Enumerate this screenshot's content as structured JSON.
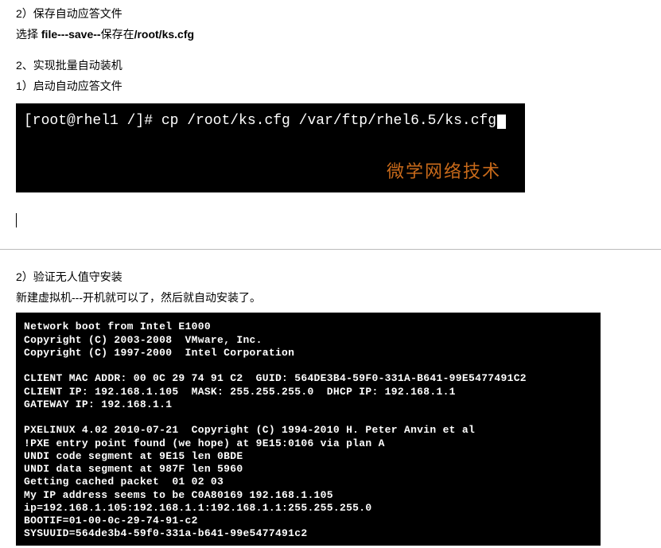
{
  "text": {
    "p1": "2）保存自动应答文件",
    "p2_prefix": "选择 ",
    "p2_bold": "file---save--",
    "p2_suffix": "保存在",
    "p2_path": "/root/ks.cfg",
    "p3": "2、实现批量自动装机",
    "p4": "1）启动自动应答文件",
    "p5": "2）验证无人值守安装",
    "p6": "新建虚拟机---开机就可以了，然后就自动安装了。"
  },
  "terminal1": {
    "prompt": "[root@rhel1 /]# cp /root/ks.cfg /var/ftp/rhel6.5/ks.cfg",
    "watermark": "微学网络技术"
  },
  "terminal2": {
    "lines": [
      "Network boot from Intel E1000",
      "Copyright (C) 2003-2008  VMware, Inc.",
      "Copyright (C) 1997-2000  Intel Corporation",
      "",
      "CLIENT MAC ADDR: 00 0C 29 74 91 C2  GUID: 564DE3B4-59F0-331A-B641-99E5477491C2",
      "CLIENT IP: 192.168.1.105  MASK: 255.255.255.0  DHCP IP: 192.168.1.1",
      "GATEWAY IP: 192.168.1.1",
      "",
      "PXELINUX 4.02 2010-07-21  Copyright (C) 1994-2010 H. Peter Anvin et al",
      "!PXE entry point found (we hope) at 9E15:0106 via plan A",
      "UNDI code segment at 9E15 len 0BDE",
      "UNDI data segment at 987F len 5960",
      "Getting cached packet  01 02 03",
      "My IP address seems to be C0A80169 192.168.1.105",
      "ip=192.168.1.105:192.168.1.1:192.168.1.1:255.255.255.0",
      "BOOTIF=01-00-0c-29-74-91-c2",
      "SYSUUID=564de3b4-59f0-331a-b641-99e5477491c2"
    ]
  }
}
